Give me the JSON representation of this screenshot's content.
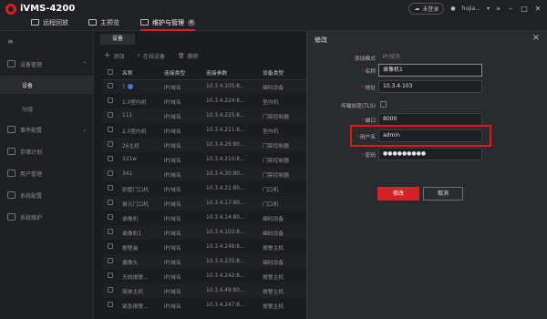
{
  "app": {
    "title": "iVMS-4200"
  },
  "nav": {
    "tabs": [
      {
        "label": "远程回放"
      },
      {
        "label": "主预览"
      },
      {
        "label": "维护与管理"
      }
    ]
  },
  "topright": {
    "cloud_label": "未登录",
    "user": "hujia..."
  },
  "sidebar": {
    "items": [
      {
        "label": "设备管理"
      },
      {
        "label": "设备"
      },
      {
        "label": "分组"
      },
      {
        "label": "事件配置"
      },
      {
        "label": "存储计划"
      },
      {
        "label": "用户管理"
      },
      {
        "label": "系统配置"
      },
      {
        "label": "系统维护"
      }
    ]
  },
  "main": {
    "subtab": "设备",
    "toolbar": {
      "add": "添加",
      "online": "在线设备",
      "delete": "删除"
    },
    "columns": [
      "名称",
      "连接类型",
      "连接参数",
      "设备类型"
    ],
    "rows": [
      {
        "name": "1",
        "type": "IP/域名",
        "ip": "10.3.4.105:8...",
        "kind": "编码设备"
      },
      {
        "name": "1.0室内机",
        "type": "IP/域名",
        "ip": "10.3.4.224:8...",
        "kind": "室内机"
      },
      {
        "name": "111",
        "type": "IP/域名",
        "ip": "10.3.4.225:8...",
        "kind": "门禁控制器"
      },
      {
        "name": "2.0室内机",
        "type": "IP/域名",
        "ip": "10.3.4.211:8...",
        "kind": "室内机"
      },
      {
        "name": "26主机",
        "type": "IP/域名",
        "ip": "10.3.4.26:80...",
        "kind": "门禁控制器"
      },
      {
        "name": "331w",
        "type": "IP/域名",
        "ip": "10.3.4.210:8...",
        "kind": "门禁控制器"
      },
      {
        "name": "341",
        "type": "IP/域名",
        "ip": "10.3.4.30:80...",
        "kind": "门禁控制器"
      },
      {
        "name": "别墅门口机",
        "type": "IP/域名",
        "ip": "10.3.4.21:80...",
        "kind": "门口机"
      },
      {
        "name": "单元门口机",
        "type": "IP/域名",
        "ip": "10.3.4.17:80...",
        "kind": "门口机"
      },
      {
        "name": "录像机",
        "type": "IP/域名",
        "ip": "10.3.4.14:80...",
        "kind": "编码设备"
      },
      {
        "name": "录像机1",
        "type": "IP/域名",
        "ip": "10.3.4.103:8...",
        "kind": "编码设备"
      },
      {
        "name": "报警盒",
        "type": "IP/域名",
        "ip": "10.3.4.248:8...",
        "kind": "报警主机"
      },
      {
        "name": "摄像头",
        "type": "IP/域名",
        "ip": "10.3.4.235:8...",
        "kind": "编码设备"
      },
      {
        "name": "无线报警...",
        "type": "IP/域名",
        "ip": "10.3.4.242:8...",
        "kind": "报警主机"
      },
      {
        "name": "简单主机",
        "type": "IP/域名",
        "ip": "10.3.4.49:80...",
        "kind": "报警主机"
      },
      {
        "name": "紧急报警...",
        "type": "IP/域名",
        "ip": "10.3.4.247:8...",
        "kind": "报警主机"
      }
    ]
  },
  "dialog": {
    "title": "修改",
    "fields": {
      "mode_label": "添加模式",
      "mode_value": "IP/域名",
      "name_label": "名称",
      "name_value": "录像机1",
      "addr_label": "地址",
      "addr_value": "10.3.4.103",
      "tls_label": "传输加密(TLS)",
      "port_label": "端口",
      "port_value": "8000",
      "user_label": "用户名",
      "user_value": "admin",
      "pwd_label": "密码",
      "pwd_value": "●●●●●●●●●"
    },
    "ok_label": "修改",
    "cancel_label": "取消"
  },
  "colors": {
    "accent": "#d71f26",
    "highlight": "#e2161d",
    "bg": "#1b1c1f",
    "dialog_bg": "#2a2b2e"
  }
}
